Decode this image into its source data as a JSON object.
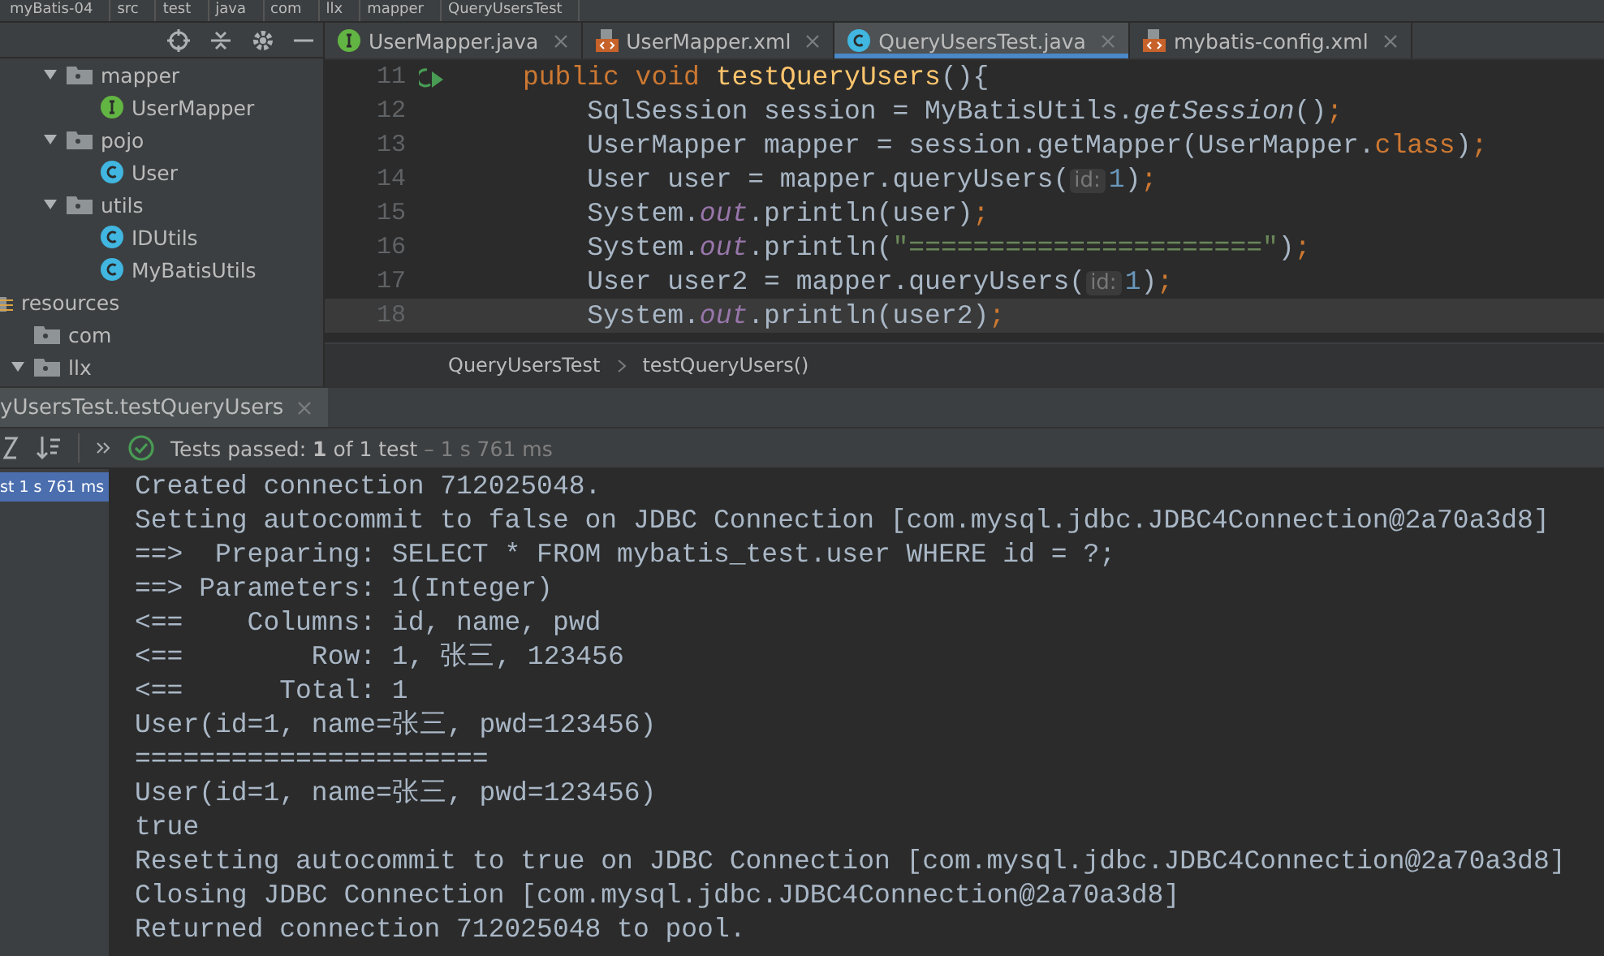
{
  "path_bar": [
    "myBatis-04",
    "src",
    "test",
    "java",
    "com",
    "llx",
    "mapper",
    "QueryUsersTest"
  ],
  "project_tree": {
    "partial_items": [
      {
        "label": "mapper",
        "kind": "package",
        "expanded": true,
        "children": [
          {
            "label": "UserMapper",
            "kind": "interface"
          }
        ]
      },
      {
        "label": "pojo",
        "kind": "package",
        "expanded": true,
        "children": [
          {
            "label": "User",
            "kind": "class"
          }
        ]
      },
      {
        "label": "utils",
        "kind": "package",
        "expanded": true,
        "children": [
          {
            "label": "IDUtils",
            "kind": "class"
          },
          {
            "label": "MyBatisUtils",
            "kind": "class"
          }
        ]
      }
    ],
    "items": [
      {
        "label": "resources",
        "kind": "resources",
        "children": [
          {
            "label": "com",
            "kind": "package"
          },
          {
            "label": "llx",
            "kind": "package",
            "expanded": true
          }
        ]
      }
    ]
  },
  "tabs": [
    {
      "label": "UserMapper.java",
      "kind": "interface",
      "selected": false
    },
    {
      "label": "UserMapper.xml",
      "kind": "xml",
      "selected": false
    },
    {
      "label": "QueryUsersTest.java",
      "kind": "class",
      "selected": true
    },
    {
      "label": "mybatis-config.xml",
      "kind": "xml",
      "selected": false
    }
  ],
  "code": [
    {
      "number": "11",
      "run_marker": true,
      "current": false,
      "tokens": [
        {
          "text": "public void ",
          "kind": "keyword"
        },
        {
          "text": "testQueryUsers",
          "kind": "method"
        },
        {
          "text": "(){",
          "kind": "plain"
        }
      ]
    },
    {
      "number": "12",
      "current": false,
      "tokens": [
        {
          "text": "    SqlSession session = MyBatisUtils.",
          "kind": "plain"
        },
        {
          "text": "getSession",
          "kind": "static"
        },
        {
          "text": "()",
          "kind": "plain"
        },
        {
          "text": ";",
          "kind": "keyword"
        }
      ]
    },
    {
      "number": "13",
      "current": false,
      "tokens": [
        {
          "text": "    UserMapper mapper = session.getMapper(UserMapper.",
          "kind": "plain"
        },
        {
          "text": "class",
          "kind": "keyword"
        },
        {
          "text": ")",
          "kind": "plain"
        },
        {
          "text": ";",
          "kind": "keyword"
        }
      ]
    },
    {
      "number": "14",
      "current": false,
      "tokens": [
        {
          "text": "    User user = mapper.queryUsers(",
          "kind": "plain"
        },
        {
          "text": "id:",
          "kind": "hint"
        },
        {
          "text": "1",
          "kind": "number"
        },
        {
          "text": ")",
          "kind": "plain"
        },
        {
          "text": ";",
          "kind": "keyword"
        }
      ]
    },
    {
      "number": "15",
      "current": false,
      "tokens": [
        {
          "text": "    System.",
          "kind": "plain"
        },
        {
          "text": "out",
          "kind": "field"
        },
        {
          "text": ".println(user)",
          "kind": "plain"
        },
        {
          "text": ";",
          "kind": "keyword"
        }
      ]
    },
    {
      "number": "16",
      "current": false,
      "tokens": [
        {
          "text": "    System.",
          "kind": "plain"
        },
        {
          "text": "out",
          "kind": "field"
        },
        {
          "text": ".println(",
          "kind": "plain"
        },
        {
          "text": "\"======================\"",
          "kind": "string"
        },
        {
          "text": ")",
          "kind": "plain"
        },
        {
          "text": ";",
          "kind": "keyword"
        }
      ]
    },
    {
      "number": "17",
      "current": false,
      "tokens": [
        {
          "text": "    User user2 = mapper.queryUsers(",
          "kind": "plain"
        },
        {
          "text": "id:",
          "kind": "hint"
        },
        {
          "text": "1",
          "kind": "number"
        },
        {
          "text": ")",
          "kind": "plain"
        },
        {
          "text": ";",
          "kind": "keyword"
        }
      ]
    },
    {
      "number": "18",
      "current": true,
      "tokens": [
        {
          "text": "    System.",
          "kind": "plain"
        },
        {
          "text": "out",
          "kind": "field"
        },
        {
          "text": ".println(user2)",
          "kind": "plain"
        },
        {
          "text": ";",
          "kind": "keyword"
        }
      ]
    }
  ],
  "editor_breadcrumb": [
    "QueryUsersTest",
    "testQueryUsers()"
  ],
  "run_panel": {
    "title": "yUsersTest.testQueryUsers",
    "status": "Tests passed: **1** of 1 test",
    "duration": "– 1 s 761 ms",
    "passed": true,
    "tests": [
      {
        "name": "st",
        "time": "1 s 761 ms",
        "selected": true
      }
    ],
    "console": [
      "Created connection 712025048.",
      "Setting autocommit to false on JDBC Connection [com.mysql.jdbc.JDBC4Connection@2a70a3d8]",
      "==>  Preparing: SELECT * FROM mybatis_test.user WHERE id = ?;",
      "==> Parameters: 1(Integer)",
      "<==    Columns: id, name, pwd",
      "<==        Row: 1, 张三, 123456",
      "<==      Total: 1",
      "User(id=1, name=张三, pwd=123456)",
      "======================",
      "User(id=1, name=张三, pwd=123456)",
      "true",
      "Resetting autocommit to true on JDBC Connection [com.mysql.jdbc.JDBC4Connection@2a70a3d8]",
      "Closing JDBC Connection [com.mysql.jdbc.JDBC4Connection@2a70a3d8]",
      "Returned connection 712025048 to pool."
    ]
  }
}
